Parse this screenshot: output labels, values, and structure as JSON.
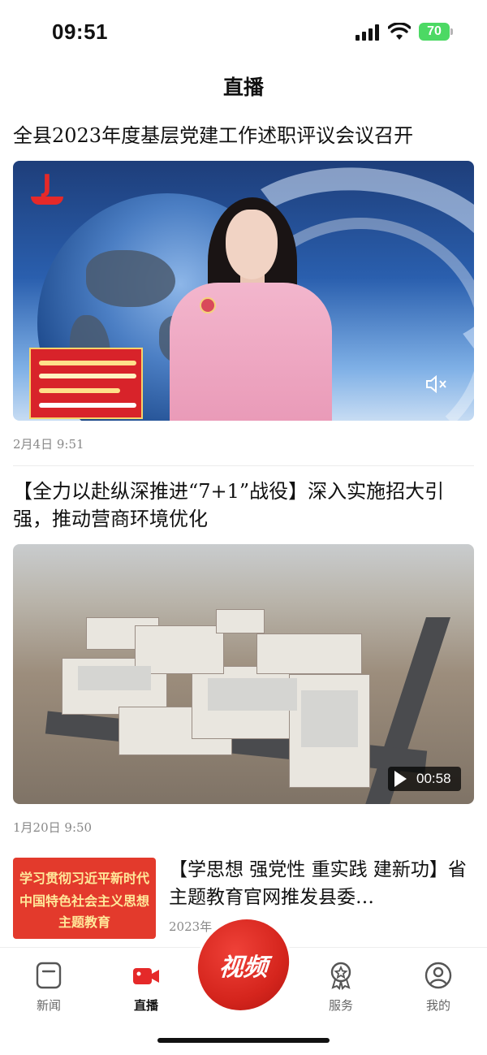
{
  "status_bar": {
    "time": "09:51",
    "battery": "70"
  },
  "header": {
    "title": "直播"
  },
  "articles": [
    {
      "title": "全县2023年度基层党建工作述职评议会议召开",
      "date": "2月4日  9:51",
      "thumbnail": {
        "kind": "news-anchor",
        "has_mute_icon": true
      }
    },
    {
      "title": "【全力以赴纵深推进“7+1”战役】深入实施招大引强，推动营商环境优化",
      "date": "1月20日  9:50",
      "thumbnail": {
        "kind": "aerial-industrial-park",
        "duration": "00:58"
      }
    },
    {
      "title": "【学思想 强党性 重实践 建新功】省主题教育官网推发县委…",
      "date": "2023年",
      "thumbnail": {
        "kind": "promo",
        "lines": [
          "学习贯彻习近平新时代",
          "中国特色社会主义思想",
          "主题教育"
        ]
      }
    }
  ],
  "tab_bar": {
    "tabs": [
      {
        "label": "新闻",
        "icon": "news-icon",
        "active": false
      },
      {
        "label": "直播",
        "icon": "live-video-icon",
        "active": true
      },
      {
        "label": "服务",
        "icon": "service-badge-icon",
        "active": false
      },
      {
        "label": "我的",
        "icon": "profile-icon",
        "active": false
      }
    ],
    "center_button": "视频"
  },
  "colors": {
    "accent": "#e52929",
    "battery": "#4cd964",
    "promo": "#e33a2c",
    "date_text": "#888888"
  }
}
